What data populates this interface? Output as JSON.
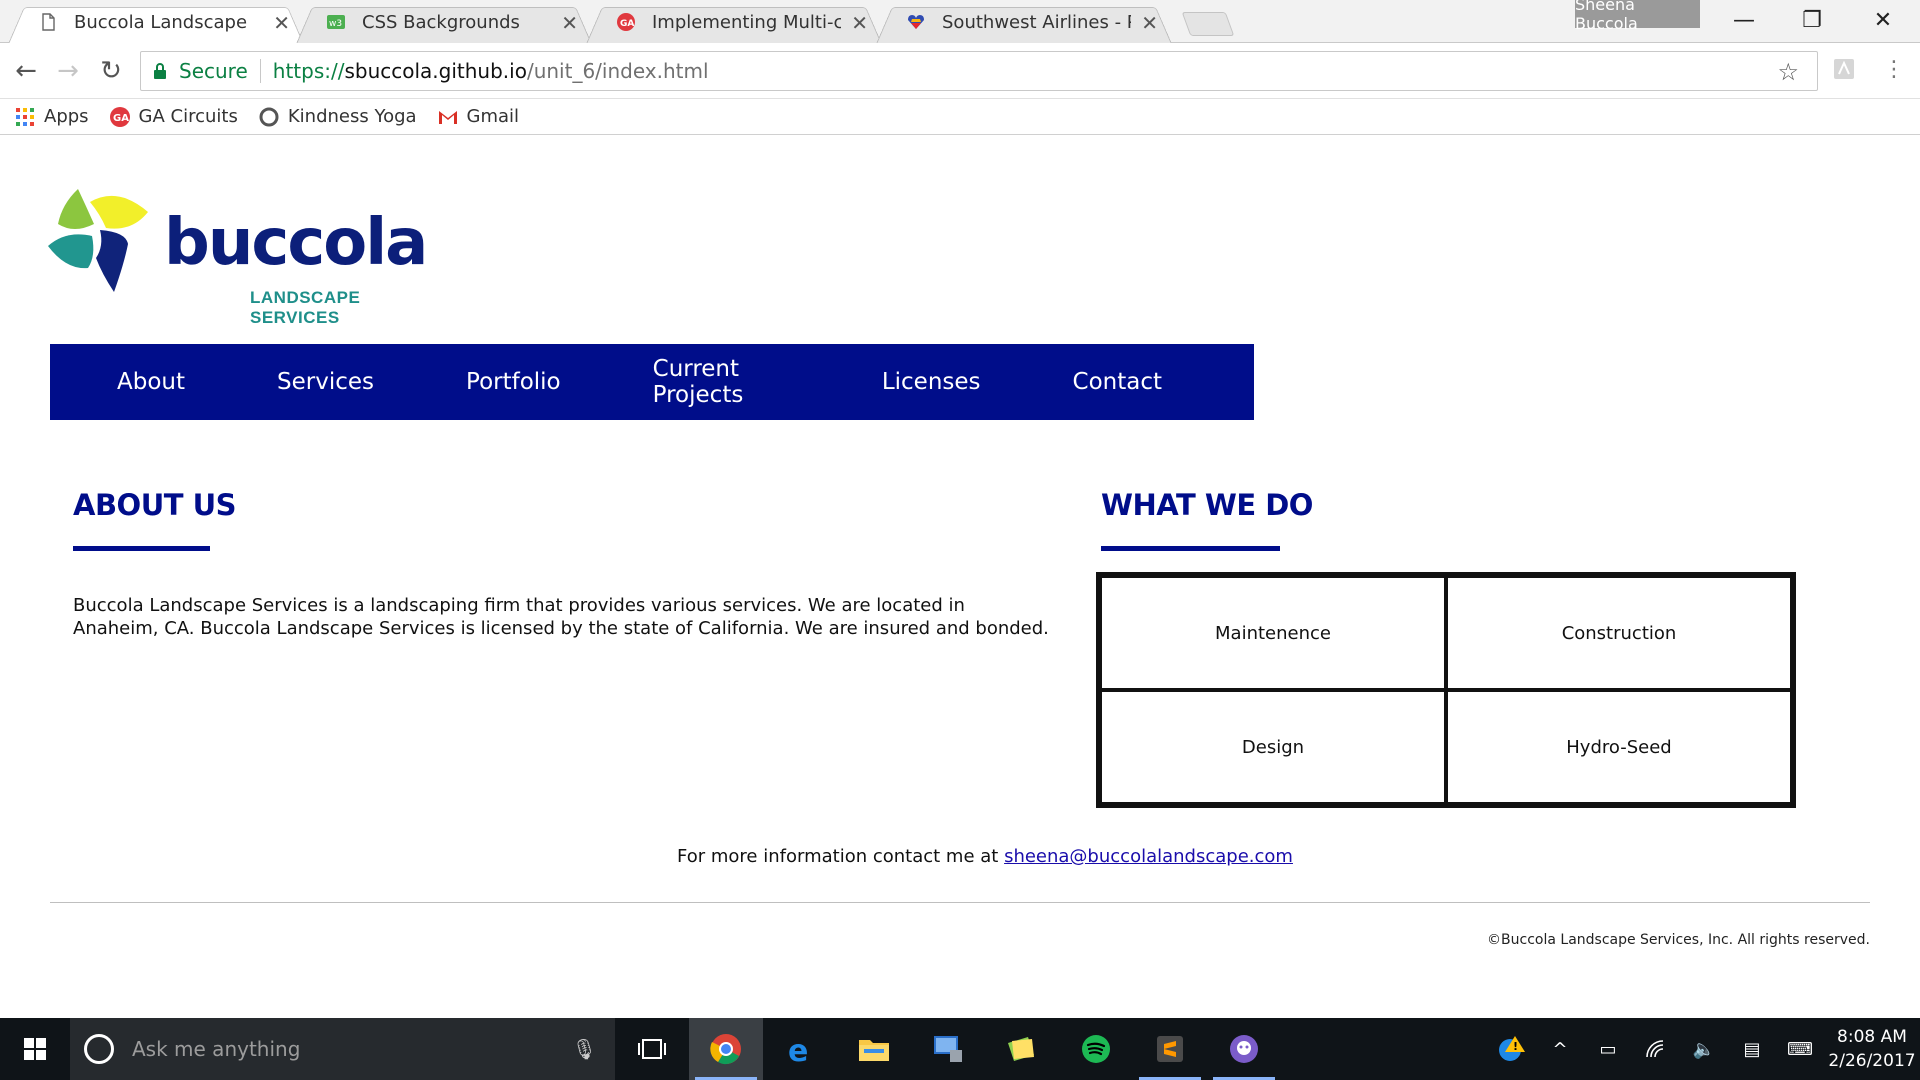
{
  "browser": {
    "tabs": [
      {
        "title": "Buccola Landscape",
        "icon": "page-icon",
        "active": true
      },
      {
        "title": "CSS Backgrounds",
        "icon": "w3schools-icon"
      },
      {
        "title": "Implementing Multi-colu",
        "icon": "ga-icon"
      },
      {
        "title": "Southwest Airlines - Payr",
        "icon": "southwest-heart-icon"
      }
    ],
    "profile_name": "Sheena Buccola",
    "secure_label": "Secure",
    "url_scheme": "https://",
    "url_host": "sbuccola.github.io",
    "url_path": "/unit_6/index.html",
    "bookmarks": [
      {
        "label": "Apps",
        "icon": "apps-grid-icon"
      },
      {
        "label": "GA Circuits",
        "icon": "ga-icon"
      },
      {
        "label": "Kindness Yoga",
        "icon": "circle-icon"
      },
      {
        "label": "Gmail",
        "icon": "gmail-icon"
      }
    ]
  },
  "site": {
    "logo": {
      "wordmark": "buccola",
      "tagline": "LANDSCAPE SERVICES"
    },
    "nav": [
      "About",
      "Services",
      "Portfolio",
      "Current Projects",
      "Licenses",
      "Contact"
    ],
    "about": {
      "title": "ABOUT US",
      "text": "Buccola Landscape Services is a landscaping firm that provides various services. We are located in Anaheim, CA. Buccola Landscape Services is licensed by the state of California. We are insured and bonded."
    },
    "what_we_do": {
      "title": "WHAT WE DO",
      "services": [
        "Maintenence",
        "Construction",
        "Design",
        "Hydro-Seed"
      ]
    },
    "contact_prefix": "For more information contact me at ",
    "contact_email": "sheena@buccolalandscape.com",
    "copyright": "©Buccola Landscape Services, Inc. All rights reserved."
  },
  "taskbar": {
    "search_placeholder": "Ask me anything",
    "time": "8:08 AM",
    "date": "2/26/2017"
  },
  "colors": {
    "brand_navy": "#000d8a",
    "nav_bg": "#000d8a",
    "link": "#1a0dab",
    "secure_green": "#0b8043"
  }
}
